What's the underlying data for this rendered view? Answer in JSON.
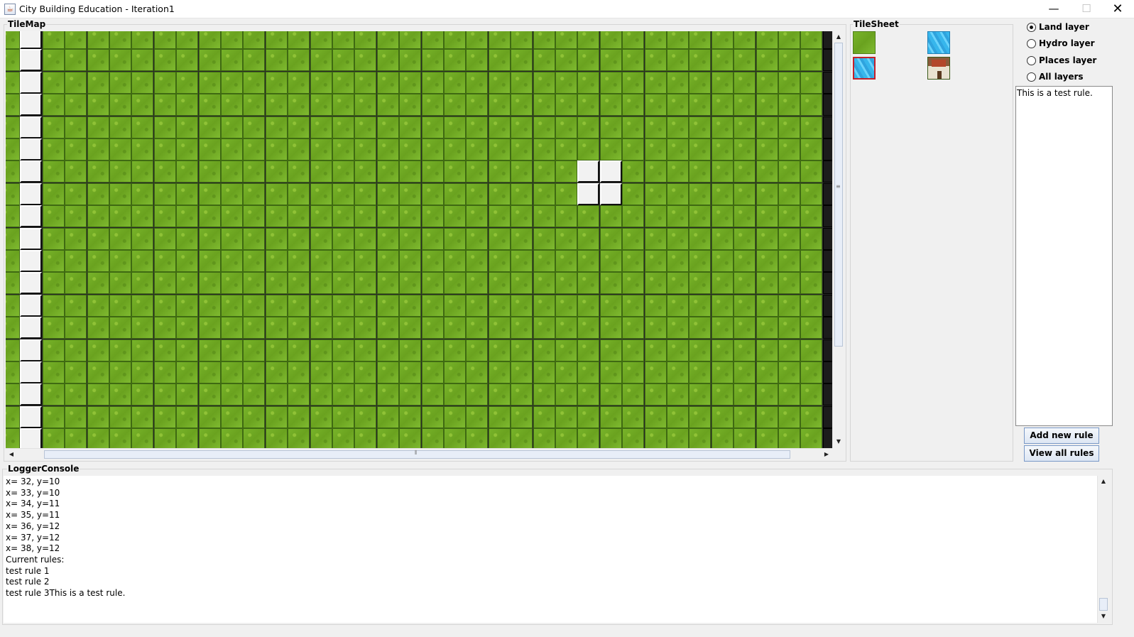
{
  "window": {
    "title": "City Building Education - Iteration1",
    "minimize": "—",
    "maximize": "☐",
    "close": "✕"
  },
  "tilemap": {
    "label": "TileMap",
    "cols": 37,
    "rows": 19,
    "blank_col": 1,
    "edge_col": 37,
    "blank_cells": [
      [
        26,
        6
      ],
      [
        27,
        6
      ],
      [
        26,
        7
      ],
      [
        27,
        7
      ]
    ],
    "scroll": {
      "up": "▲",
      "down": "▼",
      "left": "◀",
      "right": "▶"
    }
  },
  "tilesheet": {
    "label": "TileSheet",
    "tiles": [
      {
        "icon": "grass-tile-icon",
        "selected": false
      },
      {
        "icon": "water-tile-icon",
        "selected": false
      },
      {
        "icon": "water-tile-icon",
        "selected": true
      },
      {
        "icon": "house-tile-icon",
        "selected": false
      }
    ]
  },
  "layers": {
    "options": [
      {
        "label": "Land layer",
        "checked": true
      },
      {
        "label": "Hydro layer",
        "checked": false
      },
      {
        "label": "Places layer",
        "checked": false
      },
      {
        "label": "All layers",
        "checked": false
      }
    ]
  },
  "rules": {
    "text": "This is a test rule.",
    "add_button": "Add new rule",
    "view_button": "View all rules"
  },
  "logger": {
    "label": "LoggerConsole",
    "lines": [
      "x= 32, y=10",
      "x= 33, y=10",
      "x= 34, y=11",
      "x= 35, y=11",
      "x= 36, y=12",
      "x= 37, y=12",
      "x= 38, y=12",
      "Current rules:",
      "test rule 1",
      "test rule 2",
      "test rule 3This is a test rule."
    ]
  }
}
